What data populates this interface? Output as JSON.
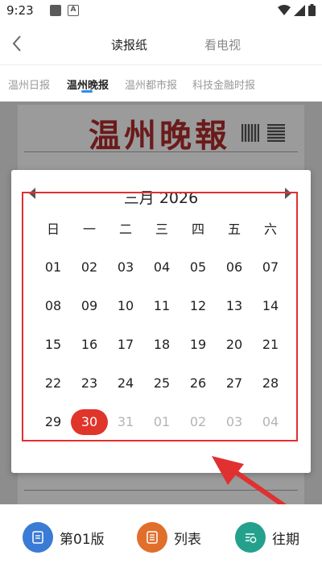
{
  "status_bar": {
    "time": "9:23",
    "a_icon": "A"
  },
  "header": {
    "tabs": [
      "读报纸",
      "看电视"
    ]
  },
  "paper_tabs": [
    "温州日报",
    "温州晚报",
    "温州都市报",
    "科技金融时报"
  ],
  "masthead": {
    "title": "温州晚報"
  },
  "date_picker": {
    "month_title": "三月 2026",
    "weekdays": [
      "日",
      "一",
      "二",
      "三",
      "四",
      "五",
      "六"
    ],
    "rows": [
      [
        "01",
        "02",
        "03",
        "04",
        "05",
        "06",
        "07"
      ],
      [
        "08",
        "09",
        "10",
        "11",
        "12",
        "13",
        "14"
      ],
      [
        "15",
        "16",
        "17",
        "18",
        "19",
        "20",
        "21"
      ],
      [
        "22",
        "23",
        "24",
        "25",
        "26",
        "27",
        "28"
      ],
      [
        "29",
        "30",
        "31",
        "01",
        "02",
        "03",
        "04"
      ]
    ],
    "selected_day": "30",
    "selected_color": "#e0352b"
  },
  "bottom_bar": {
    "items": [
      {
        "label": "第01版",
        "icon": "page-icon",
        "color": "#3a7bd5"
      },
      {
        "label": "列表",
        "icon": "list-icon",
        "color": "#e06f2c"
      },
      {
        "label": "往期",
        "icon": "history-icon",
        "color": "#23a18c"
      }
    ]
  },
  "colors": {
    "accent": "#2b8df0",
    "annotation_red": "#e03030"
  }
}
